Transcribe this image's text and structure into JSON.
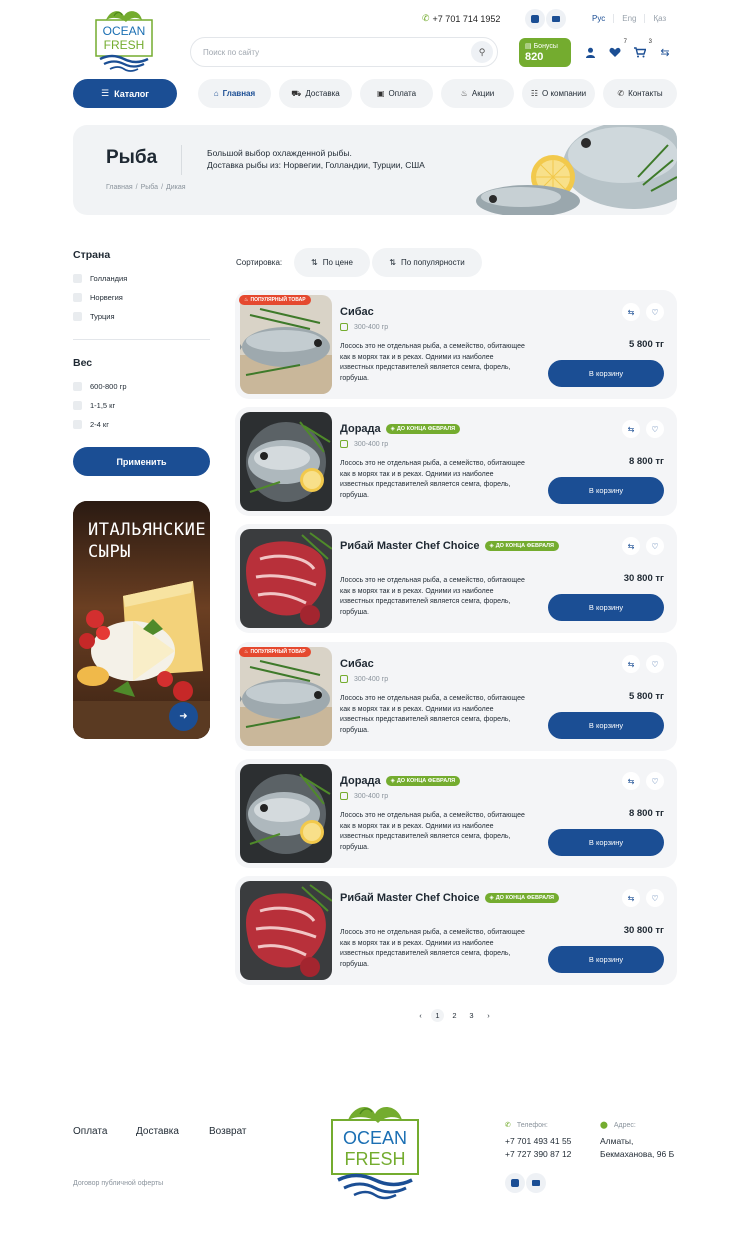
{
  "header": {
    "logo_top": "OCEAN",
    "logo_bottom": "FRESH",
    "phone": "+7 701 714 1952",
    "languages": [
      "Рус",
      "Eng",
      "Қаз"
    ],
    "search_placeholder": "Поиск по сайту",
    "bonus_label": "Бонусы",
    "bonus_value": "820",
    "favorites_count": "7",
    "cart_count": "3"
  },
  "nav": {
    "catalog": "Каталог",
    "items": [
      "Главная",
      "Доставка",
      "Оплата",
      "Акции",
      "О компании",
      "Контакты"
    ]
  },
  "hero": {
    "title": "Рыба",
    "desc_line1": "Большой выбор охлажденной рыбы.",
    "desc_line2": "Доставка рыбы из: Норвегии, Голландии, Турции, США",
    "breadcrumbs": [
      "Главная",
      "/",
      "Рыба",
      "/",
      "Дикая"
    ]
  },
  "filters": {
    "country_title": "Страна",
    "countries": [
      "Голландия",
      "Норвегия",
      "Турция"
    ],
    "weight_title": "Вес",
    "weights": [
      "600-800 гр",
      "1-1,5 кг",
      "2-4 кг"
    ],
    "apply": "Применить"
  },
  "promo": {
    "title": "ИТАЛЬЯНСКИЕ СЫРЫ"
  },
  "sort": {
    "label": "Сортировка:",
    "by_price": "По цене",
    "by_popularity": "По популярности"
  },
  "products": [
    {
      "name": "Сибас",
      "badge": "ПОПУЛЯРНЫЙ ТОВАР",
      "tag": "",
      "weight": "300-400 гр",
      "desc": "Лосось это не отдельная рыба, а семейство, обитающее как в морях так и в реках. Одними из наиболее известных представителей является семга, форель, горбуша.",
      "price": "5 800 тг",
      "button": "В корзину",
      "image": "seabass"
    },
    {
      "name": "Дорада",
      "badge": "",
      "tag": "ДО КОНЦА ФЕВРАЛЯ",
      "weight": "300-400 гр",
      "desc": "Лосось это не отдельная рыба, а семейство, обитающее как в морях так и в реках. Одними из наиболее известных представителей является семга, форель, горбуша.",
      "price": "8 800 тг",
      "button": "В корзину",
      "image": "dorado"
    },
    {
      "name": "Рибай Master Chef Choice",
      "badge": "",
      "tag": "ДО КОНЦА ФЕВРАЛЯ",
      "weight": "",
      "desc": "Лосось это не отдельная рыба, а семейство, обитающее как в морях так и в реках. Одними из наиболее известных представителей является семга, форель, горбуша.",
      "price": "30 800 тг",
      "button": "В корзину",
      "image": "steak"
    },
    {
      "name": "Сибас",
      "badge": "ПОПУЛЯРНЫЙ ТОВАР",
      "tag": "",
      "weight": "300-400 гр",
      "desc": "Лосось это не отдельная рыба, а семейство, обитающее как в морях так и в реках. Одними из наиболее известных представителей является семга, форель, горбуша.",
      "price": "5 800 тг",
      "button": "В корзину",
      "image": "seabass"
    },
    {
      "name": "Дорада",
      "badge": "",
      "tag": "ДО КОНЦА ФЕВРАЛЯ",
      "weight": "300-400 гр",
      "desc": "Лосось это не отдельная рыба, а семейство, обитающее как в морях так и в реках. Одними из наиболее известных представителей является семга, форель, горбуша.",
      "price": "8 800 тг",
      "button": "В корзину",
      "image": "dorado"
    },
    {
      "name": "Рибай Master Chef Choice",
      "badge": "",
      "tag": "ДО КОНЦА ФЕВРАЛЯ",
      "weight": "",
      "desc": "Лосось это не отдельная рыба, а семейство, обитающее как в морях так и в реках. Одними из наиболее известных представителей является семга, форель, горбуша.",
      "price": "30 800 тг",
      "button": "В корзину",
      "image": "steak"
    }
  ],
  "pagination": {
    "prev": "‹",
    "pages": [
      "1",
      "2",
      "3"
    ],
    "next": "›",
    "current": "1"
  },
  "footer": {
    "links": [
      "Оплата",
      "Доставка",
      "Возврат"
    ],
    "offer": "Договор публичной оферты",
    "phone_label": "Телефон:",
    "phones": [
      "+7 701 493 41 55",
      "+7 727 390 87 12"
    ],
    "address_label": "Адрес:",
    "address": [
      "Алматы,",
      "Бекмаханова, 96 Б"
    ]
  },
  "colors": {
    "primary": "#1b4e94",
    "accent": "#74ac2f",
    "hot": "#e5492f",
    "surface": "#f1f3f5"
  }
}
